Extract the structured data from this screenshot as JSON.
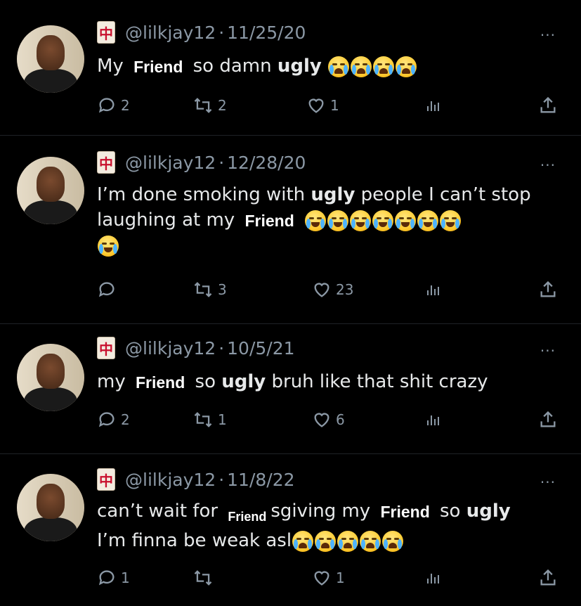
{
  "tweets": [
    {
      "handle": "@lilkjay12",
      "date": "11/25/20",
      "text": {
        "p1": "My",
        "friend": "Friend",
        "p2": "so damn",
        "bold": "ugly"
      },
      "emoji_names": [
        "loudly-crying-face",
        "loudly-crying-face",
        "loudly-crying-face",
        "loudly-crying-face"
      ],
      "replies": "2",
      "retweets": "2",
      "likes": "1"
    },
    {
      "handle": "@lilkjay12",
      "date": "12/28/20",
      "text": {
        "p1": "I’m done smoking with",
        "bold": "ugly",
        "p2": "people I can’t stop laughing at my",
        "friend": "Friend"
      },
      "emoji_names": [
        "face-with-tears-of-joy",
        "face-with-tears-of-joy",
        "face-with-tears-of-joy",
        "face-with-tears-of-joy",
        "face-with-tears-of-joy",
        "face-with-tears-of-joy",
        "face-with-tears-of-joy",
        "face-with-tears-of-joy"
      ],
      "replies": "",
      "retweets": "3",
      "likes": "23"
    },
    {
      "handle": "@lilkjay12",
      "date": "10/5/21",
      "text": {
        "p1": "my",
        "friend": "Friend",
        "p2": "so",
        "bold": "ugly",
        "p3": "bruh like that shit crazy"
      },
      "replies": "2",
      "retweets": "1",
      "likes": "6"
    },
    {
      "handle": "@lilkjay12",
      "date": "11/8/22",
      "text": {
        "p1": "can’t wait for",
        "friend_small": "Friend",
        "p2": "sgiving my",
        "friend": "Friend",
        "p3": "so",
        "bold": "ugly",
        "p4": "I’m finna be weak asl"
      },
      "emoji_names": [
        "loudly-crying-face",
        "loudly-crying-face",
        "loudly-crying-face",
        "loudly-crying-face",
        "loudly-crying-face"
      ],
      "replies": "1",
      "retweets": "",
      "likes": "1"
    }
  ],
  "separator": "·",
  "more_label": "···"
}
